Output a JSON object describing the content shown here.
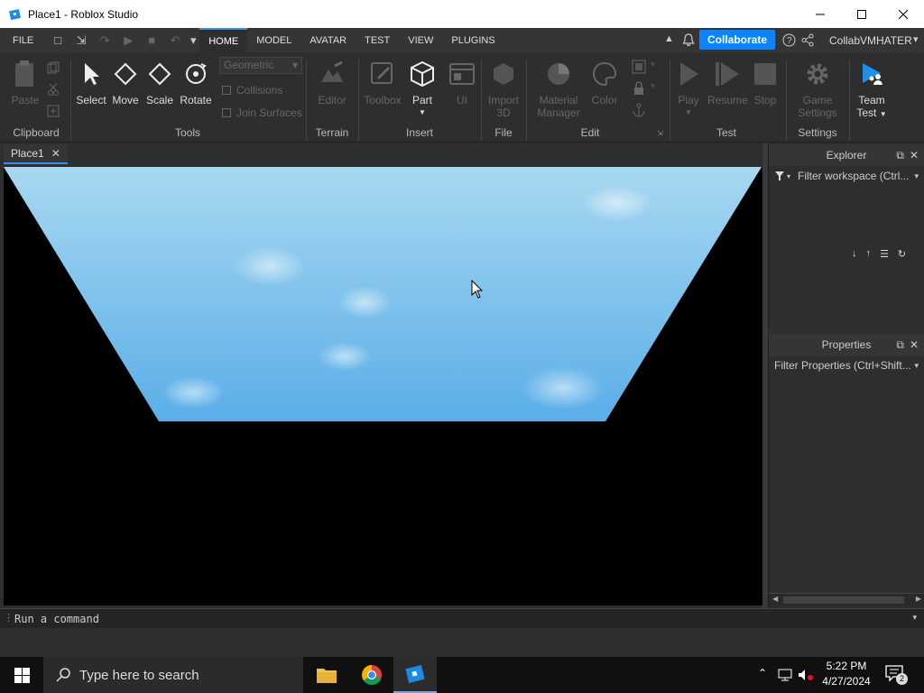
{
  "window": {
    "title": "Place1 - Roblox Studio"
  },
  "menubar": {
    "file": "FILE",
    "tabs": [
      "HOME",
      "MODEL",
      "AVATAR",
      "TEST",
      "VIEW",
      "PLUGINS"
    ],
    "active_tab": "HOME",
    "collaborate": "Collaborate",
    "username": "CollabVMHATER"
  },
  "ribbon": {
    "clipboard": {
      "paste": "Paste",
      "group": "Clipboard"
    },
    "tools": {
      "select": "Select",
      "move": "Move",
      "scale": "Scale",
      "rotate": "Rotate",
      "mode": "Geometric",
      "collisions": "Collisions",
      "join_surfaces": "Join Surfaces",
      "group": "Tools"
    },
    "terrain": {
      "editor": "Editor",
      "group": "Terrain"
    },
    "insert": {
      "toolbox": "Toolbox",
      "part": "Part",
      "ui": "UI",
      "group": "Insert"
    },
    "file": {
      "import": "Import",
      "import2": "3D",
      "group": "File"
    },
    "edit": {
      "material": "Material",
      "material2": "Manager",
      "color": "Color",
      "group": "Edit"
    },
    "test": {
      "play": "Play",
      "resume": "Resume",
      "stop": "Stop",
      "group": "Test"
    },
    "settings": {
      "game": "Game",
      "game2": "Settings",
      "group": "Settings"
    },
    "team": {
      "team": "Team",
      "test": "Test"
    }
  },
  "document_tab": {
    "label": "Place1"
  },
  "explorer": {
    "title": "Explorer",
    "filter": "Filter workspace (Ctrl..."
  },
  "properties": {
    "title": "Properties",
    "filter": "Filter Properties (Ctrl+Shift..."
  },
  "command_bar": {
    "placeholder": "Run a command"
  },
  "taskbar": {
    "search": "Type here to search",
    "time": "5:22 PM",
    "date": "4/27/2024",
    "notifications": "2"
  },
  "colors": {
    "accent": "#0a84ff",
    "sky_top": "#a8d8f0",
    "sky_bottom": "#5aaee8"
  }
}
